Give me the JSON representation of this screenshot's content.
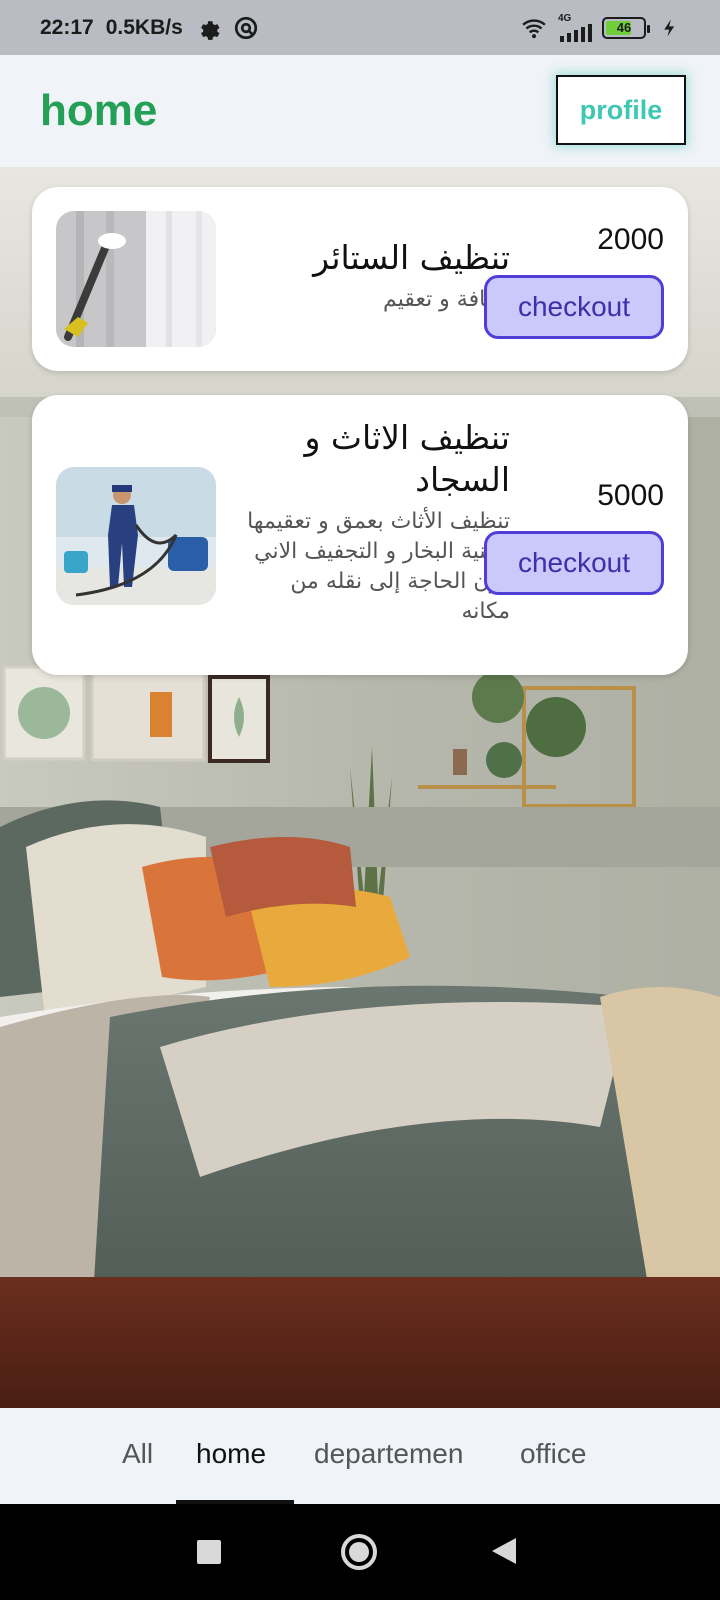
{
  "status_bar": {
    "time": "22:17",
    "speed": "0.5KB/s",
    "network": "4G",
    "battery": "46",
    "icons": [
      "gear-icon",
      "vpn-icon",
      "wifi-icon",
      "signal-icon",
      "battery-icon",
      "charging-icon"
    ]
  },
  "appbar": {
    "title": "home",
    "profile_label": "profile",
    "title_color": "#23a055",
    "profile_color": "#3ec7b3"
  },
  "cards": [
    {
      "title": "تنظيف الستائر",
      "description": "نظافة و تعقيم",
      "price": "2000",
      "checkout_label": "checkout",
      "image_icon": "curtain-steam-icon"
    },
    {
      "title": "تنظيف الاثاث و السجاد",
      "description": "تنظيف الأثاث بعمق و تعقيمها بتقنية البخار و التجفيف الاني دون الحاجة إلى نقله من مكانه",
      "price": "5000",
      "checkout_label": "checkout",
      "image_icon": "carpet-cleaner-worker-icon"
    }
  ],
  "tabs": [
    {
      "label": "All",
      "active": false
    },
    {
      "label": "home",
      "active": true
    },
    {
      "label": "departemen",
      "active": false
    },
    {
      "label": "office",
      "active": false
    }
  ],
  "colors": {
    "accent_purple": "#4f3fd6",
    "checkout_bg": "#cbc8fb"
  },
  "navigation": {
    "icons": [
      "recent-apps-icon",
      "home-icon",
      "back-icon"
    ]
  }
}
